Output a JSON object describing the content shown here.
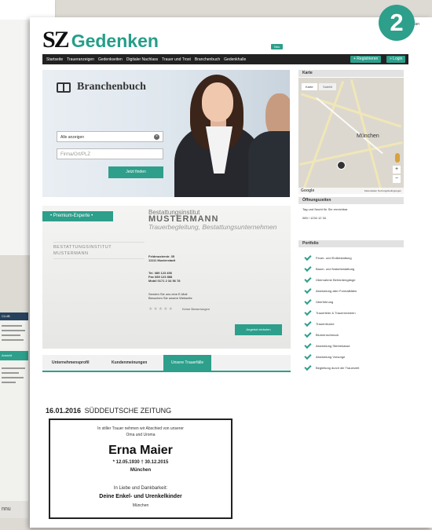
{
  "step_number": "2",
  "bg_left_bottom": {
    "header": "CLUB",
    "teal_label": "Ansicht",
    "footer": "nnu"
  },
  "header": {
    "toplinks": "sz.de | Plan",
    "logo_sz": "SZ",
    "logo_gedenken": "Gedenken",
    "new_badge": "Neu",
    "nav_items": [
      "Startseite",
      "Traueranzeigen",
      "Gedenkseiten",
      "Digitaler Nachlass",
      "Trauer und Trost",
      "Branchenbuch",
      "Gedenkhalle"
    ],
    "register_label": "+ Registrieren",
    "login_label": "» Login"
  },
  "hero": {
    "title": "Branchenbuch",
    "select_value": "Alle anzeigen",
    "location_placeholder": "Firma/Ort/PLZ",
    "search_button": "Jetzt finden"
  },
  "map": {
    "header": "Karte",
    "tab_map": "Karte",
    "tab_satellite": "Satellit",
    "city_label": "München",
    "google": "Google",
    "footer": "Kartendaten   Nutzungsbedingungen"
  },
  "hours": {
    "header": "Öffnungszeiten",
    "line1": "Tag und Nacht für Sie erreichbar",
    "line2": "089 / 1234 12 34"
  },
  "portfolio": {
    "header": "Portfolio",
    "items": [
      "Feuer- und Erdbestattung",
      "Baum- und Naturbestattung",
      "Übernahme Behördengänge",
      "Abwicklung aller Formalitäten",
      "Überführung",
      "Trauerfeier & Trauerrednerin",
      "Trauerdrucke",
      "Blumenschmuck",
      "Abwicklung Sterbekasse",
      "Abwicklung Vorsorge",
      "Begleitung durch die Trauerzeit"
    ]
  },
  "business": {
    "badge": "• Premium-Experte •",
    "logo_text": "BESTATTUNGSINSTITUT MUSTERMANN",
    "name_line1": "Bestattungsinstitut",
    "name_line2": "MUSTERMANN",
    "subtitle": "Trauerbegleitung, Bestattungsunternehmen",
    "street": "Feldmusterstr. 35",
    "city": "11111 Musterstadt",
    "tel": "Tel. 089 123 456",
    "fax": "Fax 089 123 888",
    "mobile": "Mobil 0171 2 34 56 78",
    "send_email": "Senden Sie uns eine E-Mail",
    "visit_site": "Besuchen Sie unsere Webseite",
    "stars": "★★★★★",
    "no_reviews": "Keine Bewertungen",
    "offer_button": "Angebot einholen"
  },
  "tabs": [
    "Unternehmensprofil",
    "Kundenmeinungen",
    "Unsere Trauerfälle"
  ],
  "obituary": {
    "date": "16.01.2016",
    "paper": "SÜDDEUTSCHE ZEITUNG",
    "intro1": "In stiller Trauer nehmen wir Abschied von unserer",
    "intro2": "Oma und Uroma",
    "name": "Erna Maier",
    "dates": "* 12.05.1930     † 30.12.2015",
    "place": "München",
    "gratitude": "In Liebe und Dankbarkeit:",
    "family": "Deine Enkel- und Urenkelkinder",
    "family_place": "München"
  }
}
